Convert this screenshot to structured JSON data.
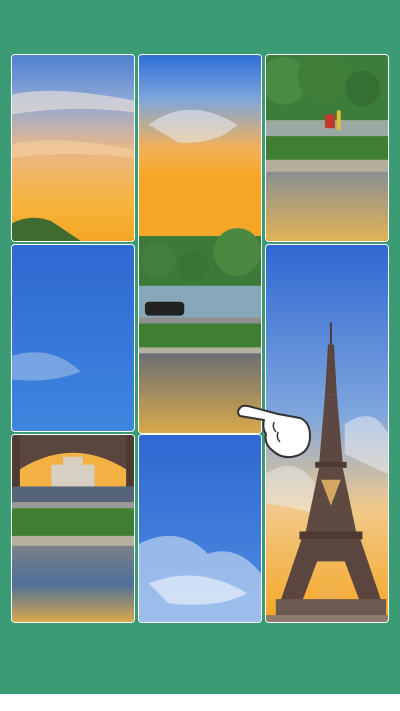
{
  "game": {
    "type": "sliding-picture-puzzle",
    "picture": "eiffel-tower-sunset",
    "colors": {
      "background": "#3a9b74",
      "tile_border": "#ffffff",
      "sky_blue": "#2f6fd6",
      "sunset_orange": "#f3a93a",
      "foliage_green": "#3c7a3a",
      "water_gold": "#d8a94c"
    },
    "tiles": [
      {
        "id": "sunset-clouds-left"
      },
      {
        "id": "sunset-sky-trees"
      },
      {
        "id": "park-trees-pond"
      },
      {
        "id": "blue-sky-left"
      },
      {
        "id": "park-road-pond"
      },
      {
        "id": "eiffel-tower"
      },
      {
        "id": "tower-arch-pond"
      },
      {
        "id": "blue-sky-clouds"
      }
    ],
    "hint": {
      "icon": "pointing-hand-icon"
    }
  }
}
